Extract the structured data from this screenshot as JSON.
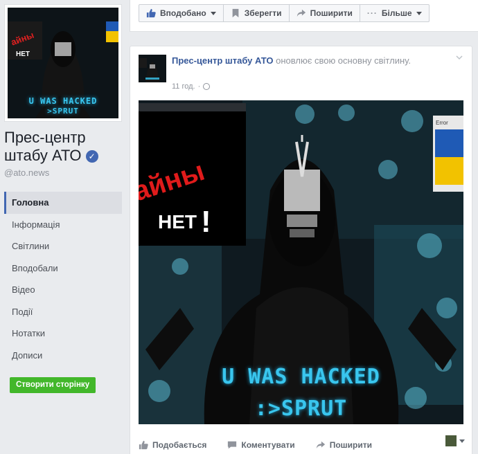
{
  "sidebar": {
    "page_name": "Прес-центр штабу АТО",
    "handle": "@ato.news",
    "nav": [
      {
        "label": "Головна",
        "active": true
      },
      {
        "label": "Інформація"
      },
      {
        "label": "Світлини"
      },
      {
        "label": "Вподобали"
      },
      {
        "label": "Відео"
      },
      {
        "label": "Події"
      },
      {
        "label": "Нотатки"
      },
      {
        "label": "Дописи"
      }
    ],
    "create_page": "Створити сторінку",
    "profile_text_line1": "U WAS HACKED",
    "profile_text_line2": ">SPRUT"
  },
  "topbar": {
    "liked": "Вподобано",
    "save": "Зберегти",
    "share": "Поширити",
    "more": "Більше"
  },
  "post": {
    "author": "Прес-центр штабу АТО",
    "action": "оновлює свою основну світлину.",
    "time": "11 год.",
    "image_text_line1": "U WAS HACKED",
    "image_text_line2": ":>SPRUT",
    "image_sign_1": "айны",
    "image_sign_2": "НЕТ",
    "image_popup_title": "Error",
    "actions": {
      "like": "Подобається",
      "comment": "Коментувати",
      "share": "Поширити"
    }
  },
  "colors": {
    "brand_blue": "#4267b2",
    "link_blue": "#365899",
    "green_button": "#42b72a",
    "background": "#e9ebee",
    "hacked_text": "#39c6ee"
  }
}
